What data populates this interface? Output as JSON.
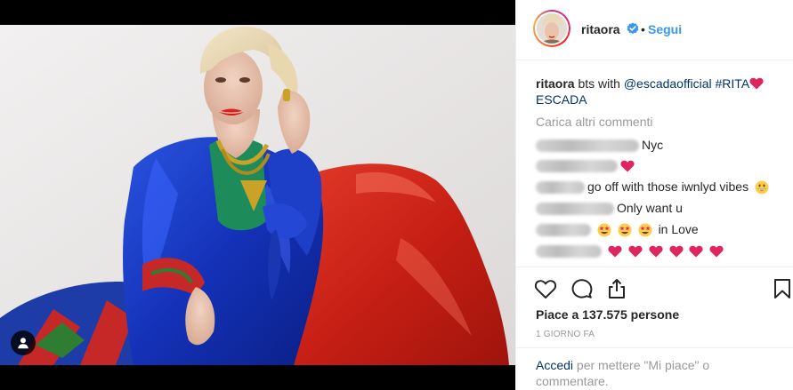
{
  "post": {
    "username": "ritaora",
    "follow_label": "Segui",
    "separator": "•",
    "caption": {
      "username": "ritaora",
      "text_before": " bts with ",
      "mention": "@escadaofficial",
      "space": " ",
      "hashtag": "#RITA",
      "after_heart": "",
      "line2": "ESCADA"
    },
    "load_more_label": "Carica altri commenti",
    "comments": [
      {
        "text": "Nyc",
        "emoji": []
      },
      {
        "text": "",
        "emoji": [
          "red-heart"
        ]
      },
      {
        "text": "go off with those iwnlyd vibes",
        "emoji_after": [
          "grinning-face"
        ]
      },
      {
        "text": "Only want u",
        "emoji": []
      },
      {
        "text": "in Love",
        "emoji": [
          "star-struck",
          "star-struck",
          "star-struck"
        ]
      },
      {
        "text": "",
        "emoji": [
          "red-heart",
          "red-heart",
          "red-heart",
          "red-heart",
          "red-heart",
          "red-heart"
        ]
      }
    ],
    "likes_text": "Piace a 137.575 persone",
    "timestamp": "1 GIORNO FA",
    "login": {
      "link": "Accedi",
      "rest": " per mettere \"Mi piace\" o commentare."
    }
  },
  "icons": [
    "user-tag-icon",
    "verified-badge-icon",
    "heart-icon",
    "comment-icon",
    "share-icon",
    "bookmark-icon"
  ],
  "colors": {
    "accent": "#3897f0",
    "verified": "#3897f0",
    "link": "#003569",
    "muted": "#999999",
    "text": "#262626",
    "heart": "#e0245e"
  }
}
